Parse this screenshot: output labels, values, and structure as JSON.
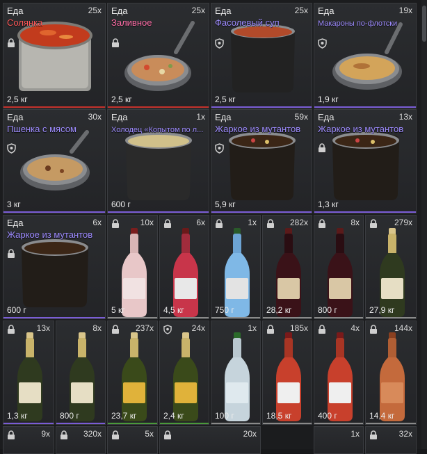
{
  "inventory": {
    "row1": [
      {
        "category": "Еда",
        "count": "25x",
        "name": "Солянка",
        "weight": "2,5 кг",
        "name_color": "#ff5a5a",
        "accent": "#c4302a"
      },
      {
        "category": "Еда",
        "count": "25x",
        "name": "Заливное",
        "weight": "2,5 кг",
        "name_color": "#ff6fa8",
        "accent": "#c4302a"
      },
      {
        "category": "Еда",
        "count": "25x",
        "name": "Фасолевый суп",
        "weight": "2,5 кг",
        "name_color": "#9e8cff",
        "accent": "#7a5cd6"
      },
      {
        "category": "Еда",
        "count": "19x",
        "name": "Макароны по-флотски",
        "weight": "1,9 кг",
        "name_color": "#9e8cff",
        "accent": "#7a5cd6"
      }
    ],
    "row2": [
      {
        "category": "Еда",
        "count": "30x",
        "name": "Пшенка с мясом",
        "weight": "3 кг",
        "name_color": "#9e8cff",
        "accent": "#7a5cd6"
      },
      {
        "category": "Еда",
        "count": "1x",
        "name": "Холодец «Копытом по л...",
        "weight": "600 г",
        "name_color": "#9e8cff",
        "accent": "#7a5cd6"
      },
      {
        "category": "Еда",
        "count": "59x",
        "name": "Жаркое из мутантов",
        "weight": "5,9 кг",
        "name_color": "#9e8cff",
        "accent": "#7a5cd6"
      },
      {
        "category": "Еда",
        "count": "13x",
        "name": "Жаркое из мутантов",
        "weight": "1,3 кг",
        "name_color": "#9e8cff",
        "accent": "#7a5cd6"
      }
    ],
    "row3_food": {
      "category": "Еда",
      "count": "6x",
      "name": "Жаркое из мутантов",
      "weight": "600 г",
      "name_color": "#9e8cff",
      "accent": "#7a5cd6"
    },
    "row3": [
      {
        "count": "10x",
        "weight": "5 кг"
      },
      {
        "count": "6x",
        "weight": "4,5 кг"
      },
      {
        "count": "1x",
        "weight": "750 г"
      },
      {
        "count": "282x",
        "weight": "28,2 кг"
      },
      {
        "count": "8x",
        "weight": "800 г"
      },
      {
        "count": "279x",
        "weight": "27,9 кг"
      }
    ],
    "row4": [
      {
        "count": "13x",
        "weight": "1,3 кг"
      },
      {
        "count": "8x",
        "weight": "800 г"
      },
      {
        "count": "237x",
        "weight": "23,7 кг"
      },
      {
        "count": "24x",
        "weight": "2,4 кг"
      },
      {
        "count": "1x",
        "weight": "100 г"
      },
      {
        "count": "185x",
        "weight": "18,5 кг"
      },
      {
        "count": "4x",
        "weight": "400 г"
      },
      {
        "count": "144x",
        "weight": "14,4 кг"
      }
    ],
    "row5": [
      {
        "count": "9x"
      },
      {
        "count": "320x"
      },
      {
        "count": "5x"
      },
      {
        "count": "20x"
      },
      {
        "count": "1x"
      },
      {
        "count": "32x"
      }
    ]
  },
  "colors": {
    "accent_red": "#c4302a",
    "accent_purple": "#7a5cd6",
    "accent_green": "#4a9a3a",
    "accent_gray": "#8a8a8a"
  }
}
